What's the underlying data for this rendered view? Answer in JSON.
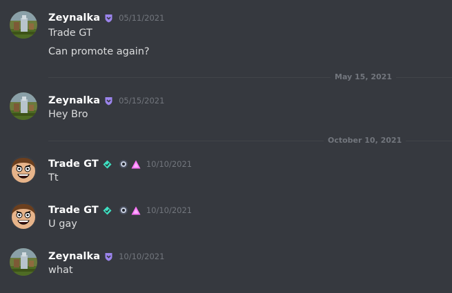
{
  "messages": [
    {
      "username": "Zeynalka",
      "timestamp": "05/11/2021",
      "lines": [
        "Trade GT",
        "Can promote again?"
      ]
    },
    {
      "username": "Zeynalka",
      "timestamp": "05/15/2021",
      "lines": [
        "Hey Bro"
      ]
    },
    {
      "username": "Trade GT",
      "timestamp": "10/10/2021",
      "lines": [
        "Tt"
      ]
    },
    {
      "username": "Trade GT",
      "timestamp": "10/10/2021",
      "lines": [
        "U gay"
      ]
    },
    {
      "username": "Zeynalka",
      "timestamp": "10/10/2021",
      "lines": [
        "what"
      ]
    }
  ],
  "dividers": [
    {
      "label": "May 15, 2021"
    },
    {
      "label": "October 10, 2021"
    }
  ],
  "colors": {
    "background": "#36393f",
    "username": "#ffffff",
    "text": "#dcddde",
    "muted": "#72767d",
    "nitro_badge": "#9b84ec",
    "hypesquad_badge": "#3ee0c2",
    "booster_badge": "#ff73fa"
  },
  "icons": [
    "avatar-zeynalka",
    "avatar-trade-gt",
    "nitro-badge-icon",
    "hypesquad-badge-icon",
    "early-supporter-badge-icon",
    "server-booster-badge-icon"
  ]
}
